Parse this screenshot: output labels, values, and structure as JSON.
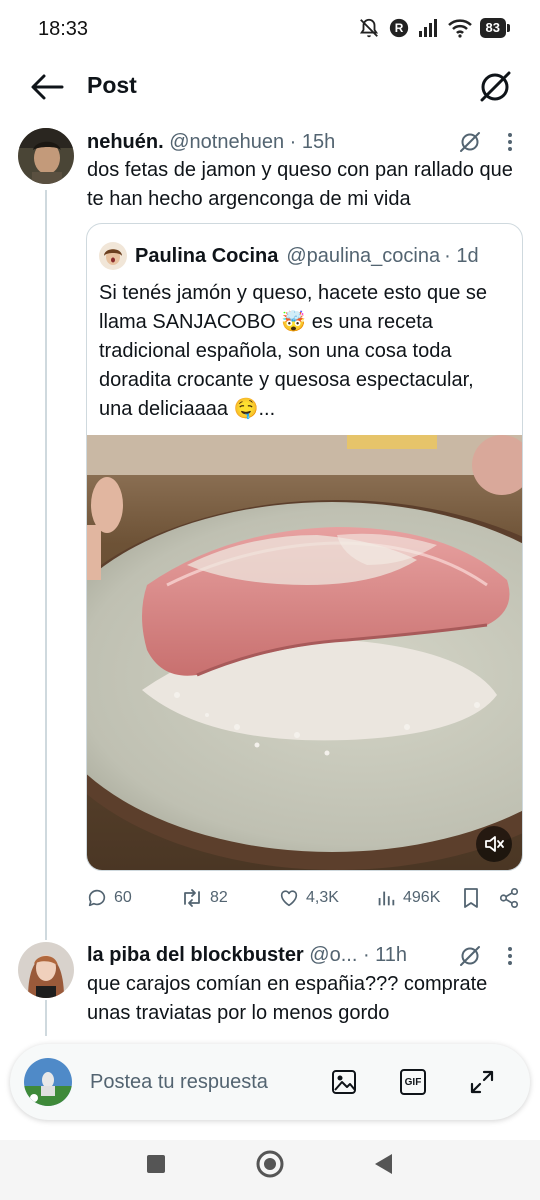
{
  "status": {
    "time": "18:33",
    "battery": "83"
  },
  "header": {
    "title": "Post"
  },
  "main_tweet": {
    "name": "nehuén.",
    "handle": "@notnehuen",
    "time": "· 15h",
    "text": "dos fetas de jamon y queso con pan rallado que te han hecho argenconga de mi vida"
  },
  "quoted_tweet": {
    "name": "Paulina Cocina",
    "handle": "@paulina_cocina",
    "time": "· 1d",
    "text": "Si tenés jamón y queso, hacete esto que se llama SANJACOBO 🤯 es una receta tradicional española, son una cosa toda doradita crocante y quesosa espectacular, una deliciaaaa 🤤..."
  },
  "actions": {
    "replies": "60",
    "reposts": "82",
    "likes": "4,3K",
    "views": "496K"
  },
  "reply_tweet": {
    "name": "la piba del blockbuster",
    "handle": "@o...",
    "time": "· 11h",
    "text": "que carajos comían en españia??? comprate unas traviatas por lo menos gordo"
  },
  "composer": {
    "placeholder": "Postea tu respuesta",
    "gif_label": "GIF"
  },
  "colors": {
    "text": "#0f1419",
    "secondary": "#536471",
    "border": "#cfd9de"
  }
}
